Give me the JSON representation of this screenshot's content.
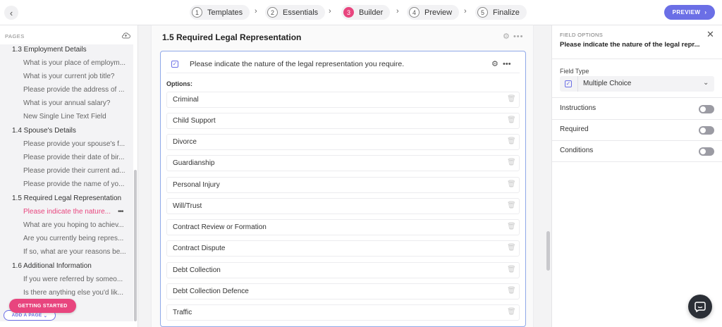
{
  "steps": [
    {
      "num": "1",
      "label": "Templates"
    },
    {
      "num": "2",
      "label": "Essentials"
    },
    {
      "num": "3",
      "label": "Builder"
    },
    {
      "num": "4",
      "label": "Preview"
    },
    {
      "num": "5",
      "label": "Finalize"
    }
  ],
  "active_step": "Builder",
  "preview_button": "PREVIEW",
  "sidebar": {
    "header": "PAGES",
    "items": [
      {
        "label": "1.3 Employment Details",
        "kind": "section"
      },
      {
        "label": "What is your place of employm...",
        "kind": "sub"
      },
      {
        "label": "What is your current job title?",
        "kind": "sub"
      },
      {
        "label": "Please provide the address of ...",
        "kind": "sub"
      },
      {
        "label": "What is your annual salary?",
        "kind": "sub"
      },
      {
        "label": "New Single Line Text Field",
        "kind": "sub"
      },
      {
        "label": "1.4 Spouse's Details",
        "kind": "section"
      },
      {
        "label": "Please provide your spouse's f...",
        "kind": "sub"
      },
      {
        "label": "Please provide their date of bir...",
        "kind": "sub"
      },
      {
        "label": "Please provide their current ad...",
        "kind": "sub"
      },
      {
        "label": "Please provide the name of yo...",
        "kind": "sub"
      },
      {
        "label": "1.5 Required Legal Representation",
        "kind": "section"
      },
      {
        "label": "Please indicate the nature...",
        "kind": "sub-active"
      },
      {
        "label": "What are you hoping to achiev...",
        "kind": "sub"
      },
      {
        "label": "Are you currently being repres...",
        "kind": "sub"
      },
      {
        "label": "If so, what are your reasons be...",
        "kind": "sub"
      },
      {
        "label": "1.6 Additional Information",
        "kind": "section"
      },
      {
        "label": "If you were referred by someo...",
        "kind": "sub"
      },
      {
        "label": "Is there anything else you'd lik...",
        "kind": "sub"
      }
    ],
    "add_page": "ADD A PAGE",
    "getting_started": "GETTING STARTED"
  },
  "main": {
    "section_title": "1.5  Required Legal Representation",
    "question": "Please indicate the nature of the legal representation you require.",
    "options_label": "Options:",
    "options": [
      "Criminal",
      "Child Support",
      "Divorce",
      "Guardianship",
      "Personal Injury",
      "Will/Trust",
      "Contract Review or Formation",
      "Contract Dispute",
      "Debt Collection",
      "Debt Collection Defence",
      "Traffic"
    ]
  },
  "field_options": {
    "header": "FIELD OPTIONS",
    "title": "Please indicate the nature of the legal repr...",
    "field_type_label": "Field Type",
    "field_type_value": "Multiple Choice",
    "toggles": [
      {
        "label": "Instructions",
        "on": false
      },
      {
        "label": "Required",
        "on": false
      },
      {
        "label": "Conditions",
        "on": false
      }
    ]
  },
  "colors": {
    "accent": "#e8457e",
    "primary": "#6b6fe6"
  }
}
